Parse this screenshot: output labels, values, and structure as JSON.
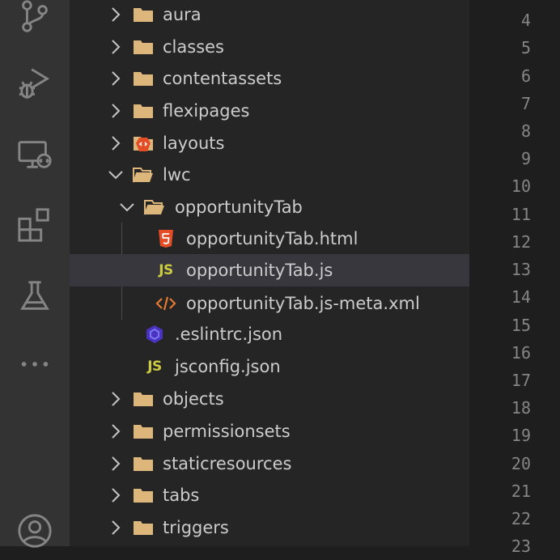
{
  "activity_bar": {
    "icons": [
      "source-control-icon",
      "run-debug-icon",
      "remote-explorer-icon",
      "extensions-icon",
      "testing-icon",
      "more-icon",
      "account-icon"
    ]
  },
  "explorer": {
    "items": [
      {
        "label": "aura",
        "type": "folder",
        "expanded": false
      },
      {
        "label": "classes",
        "type": "folder",
        "expanded": false
      },
      {
        "label": "contentassets",
        "type": "folder",
        "expanded": false
      },
      {
        "label": "flexipages",
        "type": "folder",
        "expanded": false
      },
      {
        "label": "layouts",
        "type": "folder-layouts",
        "expanded": false
      },
      {
        "label": "lwc",
        "type": "folder",
        "expanded": true
      },
      {
        "label": "opportunityTab",
        "type": "folder",
        "expanded": true
      },
      {
        "label": "opportunityTab.html",
        "type": "html"
      },
      {
        "label": "opportunityTab.js",
        "type": "js",
        "selected": true
      },
      {
        "label": "opportunityTab.js-meta.xml",
        "type": "xml"
      },
      {
        "label": ".eslintrc.json",
        "type": "eslint"
      },
      {
        "label": "jsconfig.json",
        "type": "jsconfig"
      },
      {
        "label": "objects",
        "type": "folder",
        "expanded": false
      },
      {
        "label": "permissionsets",
        "type": "folder",
        "expanded": false
      },
      {
        "label": "staticresources",
        "type": "folder",
        "expanded": false
      },
      {
        "label": "tabs",
        "type": "folder",
        "expanded": false
      },
      {
        "label": "triggers",
        "type": "folder",
        "expanded": false
      }
    ],
    "js_glyph": "JS"
  },
  "gutter": {
    "line_numbers": [
      "4",
      "5",
      "6",
      "7",
      "8",
      "9",
      "10",
      "11",
      "12",
      "13",
      "14",
      "15",
      "16",
      "17",
      "18",
      "19",
      "20",
      "21",
      "22",
      "23"
    ]
  },
  "colors": {
    "activity_bar_bg": "#333333",
    "sidebar_bg": "#252526",
    "editor_bg": "#1e1e1e",
    "selection_bg": "#37373d",
    "folder": "#dcb67a",
    "html": "#e44d26",
    "js": "#cbcb41",
    "xml": "#e37933",
    "eslint": "#4b32c3"
  }
}
